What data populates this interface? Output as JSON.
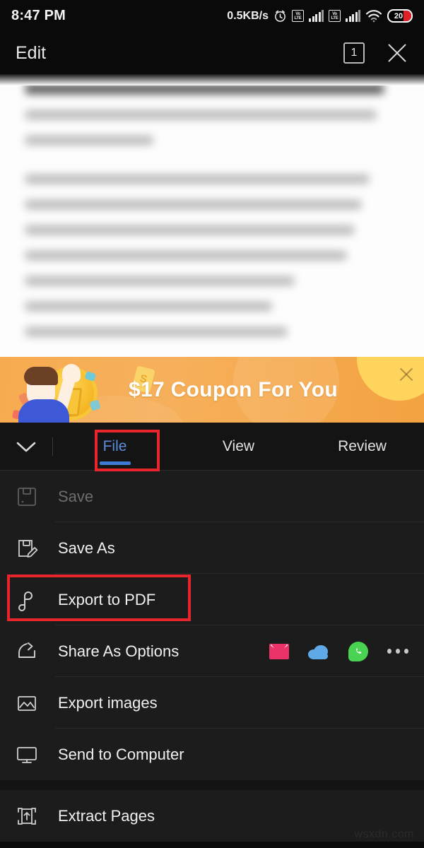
{
  "status_bar": {
    "time": "8:47 PM",
    "network_speed": "0.5KB/s",
    "alarm_icon": "alarm-clock-icon",
    "sim1_label": "VoLTE",
    "sim2_label": "VoLTE",
    "wifi_icon": "wifi-icon",
    "battery_percent": "20"
  },
  "title_bar": {
    "title": "Edit",
    "tab_count": "1",
    "close_icon": "close-icon"
  },
  "document": {
    "state": "blurred",
    "line_count": 10
  },
  "banner": {
    "text": "$17 Coupon For You",
    "coin_tag_symbol": "S",
    "close_icon": "close-icon",
    "background_color": "#f5ab50",
    "text_color": "#ffffff"
  },
  "tab_bar": {
    "collapse_icon": "chevron-down-icon",
    "tabs": [
      {
        "label": "File",
        "active": true
      },
      {
        "label": "View",
        "active": false
      },
      {
        "label": "Review",
        "active": false
      }
    ],
    "active_color": "#5b8ddb",
    "indicator_color": "#3e7bd4"
  },
  "menu": {
    "items": [
      {
        "label": "Save",
        "icon": "floppy-disk-icon",
        "disabled": true
      },
      {
        "label": "Save As",
        "icon": "floppy-disk-edit-icon",
        "disabled": false
      },
      {
        "label": "Export to PDF",
        "icon": "pdf-icon",
        "disabled": false
      },
      {
        "label": "Share As Options",
        "icon": "share-arrow-icon",
        "disabled": false
      },
      {
        "label": "Export images",
        "icon": "image-icon",
        "disabled": false
      },
      {
        "label": "Send to Computer",
        "icon": "monitor-icon",
        "disabled": false
      },
      {
        "label": "Extract Pages",
        "icon": "extract-pages-icon",
        "disabled": false
      }
    ],
    "share_apps": [
      {
        "name": "email-icon",
        "color": "#ec3369"
      },
      {
        "name": "cloud-icon",
        "color": "#5fa9e6"
      },
      {
        "name": "whatsapp-icon",
        "color": "#4ad353"
      },
      {
        "name": "more-options-icon",
        "color": "#c9c9c9"
      }
    ]
  },
  "annotations": {
    "color": "#e8252c",
    "boxes": [
      "file-tab",
      "export-to-pdf-row"
    ]
  },
  "watermark": {
    "text": "wsxdn.com"
  }
}
